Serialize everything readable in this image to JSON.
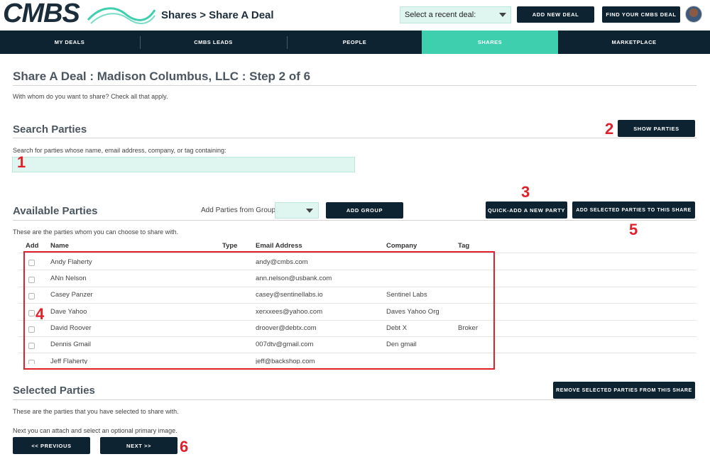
{
  "header": {
    "logo_text": "CMBS",
    "breadcrumb": "Shares > Share A Deal",
    "recent_deal_select": "Select a recent deal:",
    "add_new_deal_label": "ADD NEW DEAL",
    "find_deal_label": "FIND YOUR CMBS DEAL"
  },
  "nav": {
    "items": [
      {
        "label": "MY DEALS"
      },
      {
        "label": "CMBS LEADS"
      },
      {
        "label": "PEOPLE"
      },
      {
        "label": "SHARES"
      },
      {
        "label": "MARKETPLACE"
      }
    ],
    "active": "SHARES"
  },
  "page": {
    "title": "Share A Deal : Madison Columbus, LLC : Step 2 of 6",
    "intro": "With whom do you want to share? Check all that apply."
  },
  "search": {
    "heading": "Search Parties",
    "show_parties_label": "SHOW PARTIES",
    "hint": "Search for parties whose name, email address, company, or tag containing:",
    "value": ""
  },
  "available": {
    "heading": "Available Parties",
    "group_label": "Add Parties from Group",
    "add_group_label": "ADD GROUP",
    "quick_add_label": "QUICK-ADD A NEW PARTY",
    "add_selected_label": "ADD SELECTED PARTIES TO THIS SHARE",
    "description": "These are the parties whom you can choose to share with.",
    "columns": {
      "add": "Add",
      "name": "Name",
      "type": "Type",
      "email": "Email Address",
      "company": "Company",
      "tag": "Tag"
    },
    "rows": [
      {
        "name": "Andy Flaherty",
        "type": "",
        "email": "andy@cmbs.com",
        "company": "",
        "tag": ""
      },
      {
        "name": "ANn Nelson",
        "type": "",
        "email": "ann.nelson@usbank.com",
        "company": "",
        "tag": ""
      },
      {
        "name": "Casey Panzer",
        "type": "",
        "email": "casey@sentinellabs.io",
        "company": "Sentinel Labs",
        "tag": ""
      },
      {
        "name": "Dave Yahoo",
        "type": "",
        "email": "xerxxees@yahoo.com",
        "company": "Daves Yahoo Org",
        "tag": ""
      },
      {
        "name": "David Roover",
        "type": "",
        "email": "droover@debtx.com",
        "company": "Debt X",
        "tag": "Broker"
      },
      {
        "name": "Dennis Gmail",
        "type": "",
        "email": "007dtv@gmail.com",
        "company": "Den gmail",
        "tag": ""
      },
      {
        "name": "Jeff Flaherty",
        "type": "",
        "email": "jeff@backshop.com",
        "company": "",
        "tag": ""
      }
    ]
  },
  "selected": {
    "heading": "Selected Parties",
    "remove_label": "REMOVE SELECTED PARTIES FROM THIS SHARE",
    "description": "These are the parties that you have selected to share with."
  },
  "footer": {
    "next_hint": "Next you can attach and select an optional primary image.",
    "previous_label": "<< PREVIOUS",
    "next_label": "NEXT >>"
  },
  "annotations": [
    "1",
    "2",
    "3",
    "4",
    "5",
    "6"
  ],
  "colors": {
    "navy": "#0e2332",
    "teal": "#3ecfae",
    "mint": "#dff5ef",
    "annotation_red": "#e0202a"
  }
}
